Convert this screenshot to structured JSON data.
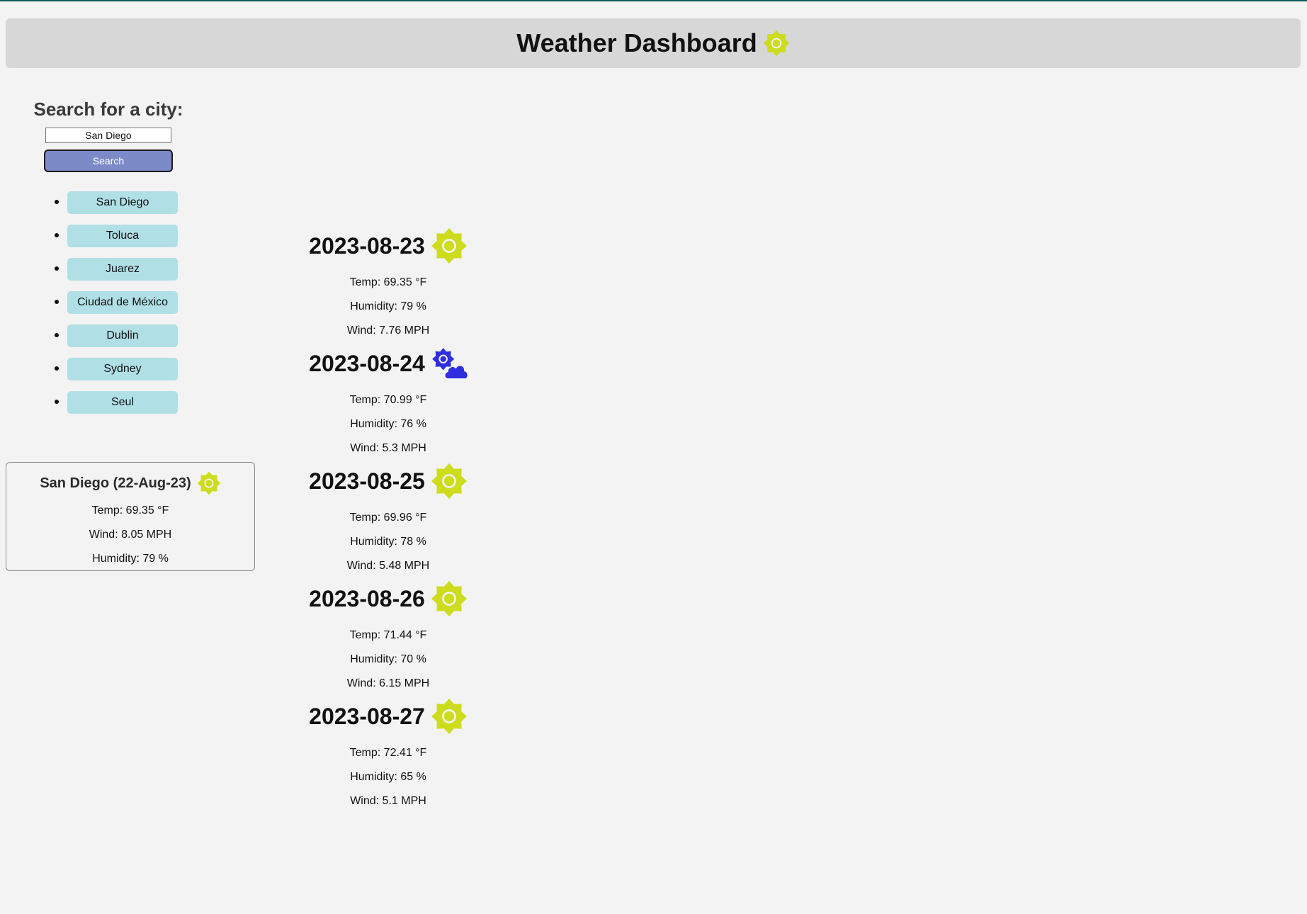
{
  "header": {
    "title": "Weather Dashboard",
    "icon": "sun-icon",
    "icon_color": "#cddc1c"
  },
  "search": {
    "heading": "Search for a city:",
    "input_value": "San Diego",
    "button_label": "Search",
    "button_color": "#7c8bc8"
  },
  "history": {
    "button_color": "#b0dfe6",
    "cities": [
      "San Diego",
      "Toluca",
      "Juarez",
      "Ciudad de México",
      "Dublin",
      "Sydney",
      "Seul"
    ]
  },
  "current": {
    "title": "San Diego (22-Aug-23)",
    "icon": "sun-icon",
    "temp": "Temp: 69.35 °F",
    "wind": "Wind: 8.05 MPH",
    "humidity": "Humidity: 79 %"
  },
  "forecast": [
    {
      "date": "2023-08-23",
      "icon": "sun-icon",
      "temp": "Temp: 69.35 °F",
      "humidity": "Humidity: 79 %",
      "wind": "Wind: 7.76 MPH"
    },
    {
      "date": "2023-08-24",
      "icon": "partly-cloudy-icon",
      "temp": "Temp: 70.99 °F",
      "humidity": "Humidity: 76 %",
      "wind": "Wind: 5.3 MPH"
    },
    {
      "date": "2023-08-25",
      "icon": "sun-icon",
      "temp": "Temp: 69.96 °F",
      "humidity": "Humidity: 78 %",
      "wind": "Wind: 5.48 MPH"
    },
    {
      "date": "2023-08-26",
      "icon": "sun-icon",
      "temp": "Temp: 71.44 °F",
      "humidity": "Humidity: 70 %",
      "wind": "Wind: 6.15 MPH"
    },
    {
      "date": "2023-08-27",
      "icon": "sun-icon",
      "temp": "Temp: 72.41 °F",
      "humidity": "Humidity: 65 %",
      "wind": "Wind: 5.1 MPH"
    }
  ],
  "colors": {
    "sun": "#cddc1c",
    "cloud": "#2e2ee0"
  }
}
